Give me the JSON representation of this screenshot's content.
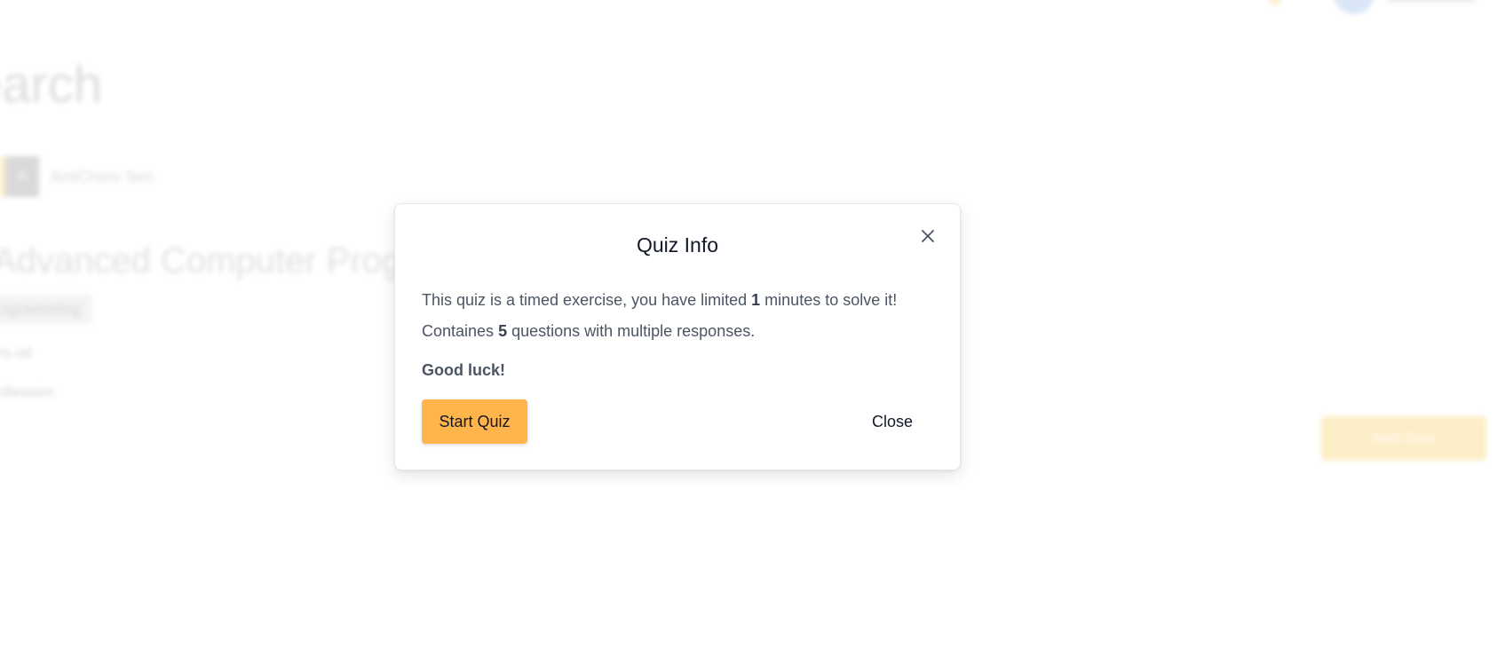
{
  "background": {
    "page_title": "earch",
    "author_initial": "A",
    "author_name": "AmiChoru Sen",
    "course_title": "Advanced Computer Progra",
    "tag": "ogramming",
    "detail_1": "rs.od",
    "detail_2": "ofession",
    "enroll_button": "Add Quiz"
  },
  "modal": {
    "title": "Quiz Info",
    "close_icon": "close-x-icon",
    "line1_before": "This quiz is a timed exercise, you have limited ",
    "minutes": "1",
    "line1_after": " minutes to solve it!",
    "line2_before": "Containes ",
    "questions": "5",
    "line2_after": " questions with multiple responses.",
    "good_luck": "Good luck!",
    "start_button": "Start Quiz",
    "close_button": "Close"
  },
  "colors": {
    "accent": "#ffb54c",
    "title_text": "#111827",
    "body_text": "#4b5563"
  }
}
